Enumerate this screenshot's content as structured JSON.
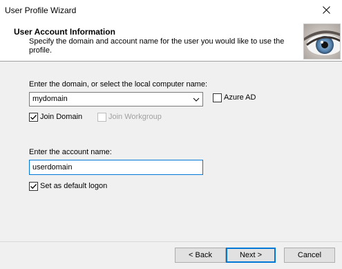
{
  "window": {
    "title": "User Profile Wizard"
  },
  "header": {
    "title": "User Account Information",
    "description": "Specify the domain and account name for the user you would like to use the profile."
  },
  "domain": {
    "label": "Enter the domain, or select the local computer name:",
    "value": "mydomain",
    "azure_ad_label": "Azure AD",
    "azure_ad_checked": false,
    "join_domain_label": "Join Domain",
    "join_domain_checked": true,
    "join_workgroup_label": "Join Workgroup",
    "join_workgroup_checked": false,
    "join_workgroup_enabled": false
  },
  "account": {
    "label": "Enter the account name:",
    "value": "userdomain",
    "default_logon_label": "Set as default logon",
    "default_logon_checked": true
  },
  "buttons": {
    "back": "< Back",
    "next": "Next >",
    "cancel": "Cancel"
  },
  "colors": {
    "accent": "#0078d7",
    "iris": "#5a86b0"
  },
  "icons": {
    "close": "close-icon",
    "combo_arrow": "chevron-down-icon",
    "header_image": "eye-image"
  }
}
